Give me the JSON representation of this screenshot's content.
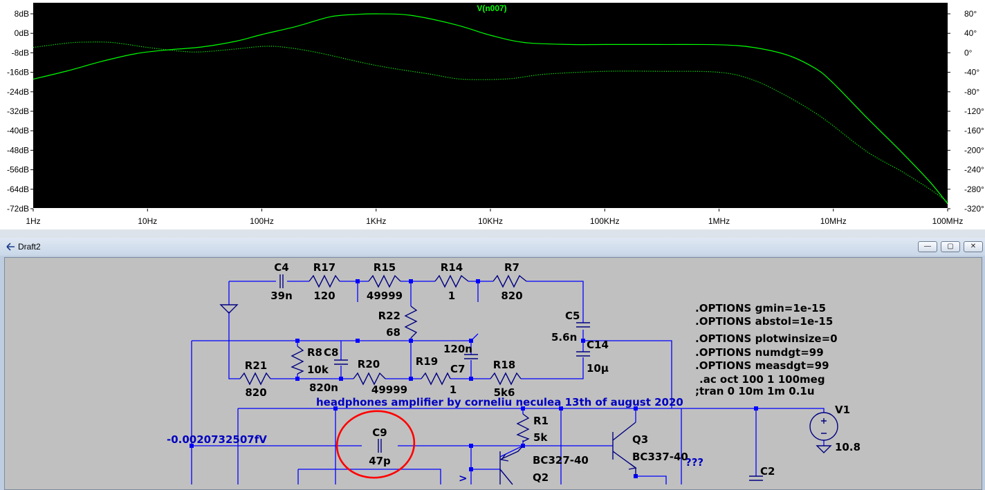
{
  "plot": {
    "trace_title": "V(n007)",
    "left_axis_labels": [
      "8dB",
      "0dB",
      "-8dB",
      "-16dB",
      "-24dB",
      "-32dB",
      "-40dB",
      "-48dB",
      "-56dB",
      "-64dB",
      "-72dB"
    ],
    "right_axis_labels": [
      "80°",
      "40°",
      "0°",
      "-40°",
      "-80°",
      "-120°",
      "-160°",
      "-200°",
      "-240°",
      "-280°",
      "-320°"
    ],
    "x_axis_labels": [
      "1Hz",
      "10Hz",
      "100Hz",
      "1KHz",
      "10KHz",
      "100KHz",
      "1MHz",
      "10MHz",
      "100MHz"
    ],
    "colors": {
      "background": "#000000",
      "trace": "#00ff00",
      "grid": "#ffffff"
    }
  },
  "chart_data": {
    "type": "line",
    "xscale": "log",
    "xlim": [
      1,
      100000000
    ],
    "ylim_left": [
      -72,
      8
    ],
    "ylim_right": [
      -320,
      80
    ],
    "series": [
      {
        "name": "V(n007)",
        "style": "solid",
        "x": [
          1,
          2,
          4,
          8,
          15,
          30,
          60,
          100,
          200,
          400,
          700,
          1000,
          2000,
          5000,
          10000,
          20000,
          50000,
          100000,
          300000,
          1000000,
          2000000,
          4000000,
          7000000,
          10000000,
          20000000,
          40000000,
          70000000,
          100000000
        ],
        "y": [
          -18.8,
          -15.4,
          -11.5,
          -8.3,
          -6.8,
          -5.6,
          -3.2,
          -0.5,
          2.8,
          6.8,
          7.8,
          8.0,
          7.4,
          3.5,
          -0.8,
          -3.8,
          -4.6,
          -4.6,
          -4.6,
          -4.7,
          -5.8,
          -9.0,
          -14.5,
          -20.5,
          -35.0,
          -49.0,
          -61.0,
          -70.0
        ]
      },
      {
        "name": "V(n007) phase",
        "style": "dotted",
        "x": [
          1,
          2,
          3,
          5,
          10,
          20,
          30,
          60,
          100,
          150,
          300,
          1000,
          3000,
          5000,
          8000,
          15000,
          30000,
          100000,
          300000,
          1000000,
          2000000,
          4000000,
          7000000,
          10000000,
          20000000,
          40000000,
          70000000,
          100000000
        ],
        "y": [
          11,
          20,
          22,
          21,
          11,
          3,
          2,
          8,
          13,
          12,
          1,
          -26,
          -44,
          -53,
          -55,
          -53,
          -44,
          -38,
          -38,
          -40,
          -56,
          -90,
          -124,
          -150,
          -204,
          -244,
          -280,
          -306
        ]
      }
    ]
  },
  "window": {
    "title": "Draft2",
    "minimize_glyph": "—",
    "maximize_glyph": "▢",
    "close_glyph": "✕"
  },
  "schematic": {
    "labels": {
      "C4": "C4",
      "C4_val": "39n",
      "R17": "R17",
      "R17_val": "120",
      "R15": "R15",
      "R15_val": "49999",
      "R14": "R14",
      "R14_val": "1",
      "R7": "R7",
      "R7_val": "820",
      "R22": "R22",
      "R22_val": "68",
      "C5": "C5",
      "C5_val": "5.6n",
      "C14": "C14",
      "C14_val": "10µ",
      "R8": "R8",
      "R8_val": "10k",
      "C8": "C8",
      "C8_val": "820n",
      "R20": "R20",
      "R20_val": "49999",
      "R19": "R19",
      "R19_val": "1",
      "C7": "C7",
      "C7_val": "120n",
      "R18": "R18",
      "R18_val": "5k6",
      "R21": "R21",
      "R21_val": "820",
      "R1": "R1",
      "R1_val": "5k",
      "C9": "C9",
      "C9_val": "47p",
      "Q3": "Q3",
      "Q3_model": "BC337-40",
      "Q2": "Q2",
      "Q2_model": "BC327-40",
      "V1": "V1",
      "V1_val": "10.8",
      "C2": "C2",
      "qmarks": "???",
      "v_arrow": ">"
    },
    "directives": [
      ".OPTIONS gmin=1e-15",
      ".OPTIONS abstol=1e-15",
      ".OPTIONS plotwinsize=0",
      ".OPTIONS numdgt=99",
      ".OPTIONS measdgt=99",
      ".ac oct 100 1 100meg",
      ";tran 0 10m 1m 0.1u"
    ],
    "comment": "headphones amplifier by corneliu neculea 13th of august 2020",
    "probe_value": "-0.0020732507fV",
    "colors": {
      "wire": "#0000ff",
      "background": "#c0c0c0",
      "highlight": "#ff0000",
      "text_blue": "#0000c0"
    }
  }
}
